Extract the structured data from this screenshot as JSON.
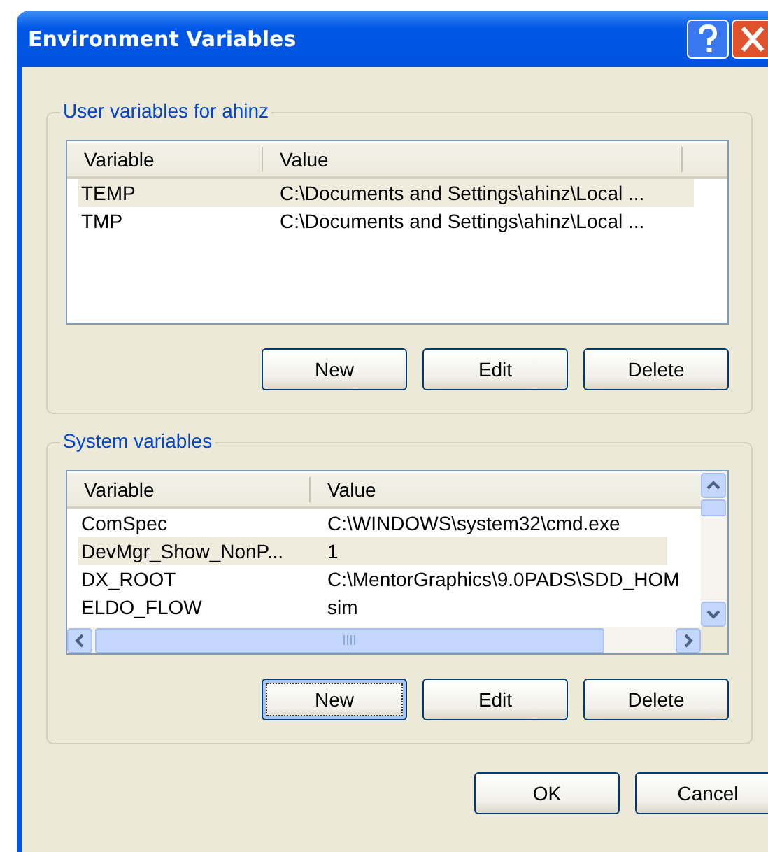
{
  "window": {
    "title": "Environment Variables"
  },
  "groups": [
    {
      "title": "User variables for ahinz",
      "columns": [
        "Variable",
        "Value"
      ],
      "scrollbars": false,
      "rows": [
        {
          "variable": "TEMP",
          "value": "C:\\Documents and Settings\\ahinz\\Local ...",
          "selected": true
        },
        {
          "variable": "TMP",
          "value": "C:\\Documents and Settings\\ahinz\\Local ...",
          "selected": false
        }
      ],
      "buttons": [
        {
          "label": "New",
          "focused": false
        },
        {
          "label": "Edit",
          "focused": false
        },
        {
          "label": "Delete",
          "focused": false
        }
      ]
    },
    {
      "title": "System variables",
      "columns": [
        "Variable",
        "Value"
      ],
      "scrollbars": true,
      "rows": [
        {
          "variable": "ComSpec",
          "value": "C:\\WINDOWS\\system32\\cmd.exe",
          "selected": false
        },
        {
          "variable": "DevMgr_Show_NonP...",
          "value": "1",
          "selected": true
        },
        {
          "variable": "DX_ROOT",
          "value": "C:\\MentorGraphics\\9.0PADS\\SDD_HOM",
          "selected": false
        },
        {
          "variable": "ELDO_FLOW",
          "value": "sim",
          "selected": false
        }
      ],
      "buttons": [
        {
          "label": "New",
          "focused": true
        },
        {
          "label": "Edit",
          "focused": false
        },
        {
          "label": "Delete",
          "focused": false
        }
      ]
    }
  ],
  "buttons": [
    "OK",
    "Cancel"
  ]
}
